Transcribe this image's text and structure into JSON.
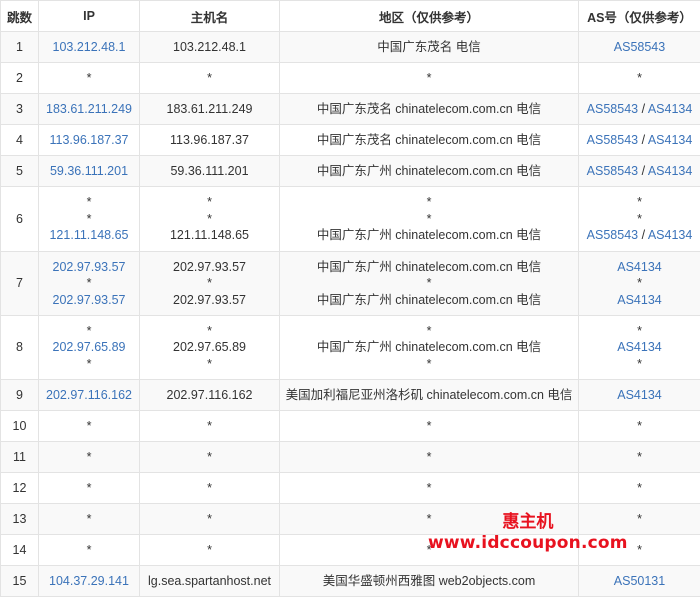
{
  "table": {
    "headers": {
      "hop": "跳数",
      "ip": "IP",
      "host": "主机名",
      "location": "地区（仅供参考）",
      "as": "AS号（仅供参考）"
    },
    "rows": [
      {
        "hop": "1",
        "ip": [
          "103.212.48.1"
        ],
        "host": [
          "103.212.48.1"
        ],
        "loc": [
          "中国广东茂名 电信"
        ],
        "as": [
          [
            "AS58543"
          ]
        ]
      },
      {
        "hop": "2",
        "ip": [
          "*"
        ],
        "host": [
          "*"
        ],
        "loc": [
          "*"
        ],
        "as": [
          [
            "*"
          ]
        ]
      },
      {
        "hop": "3",
        "ip": [
          "183.61.211.249"
        ],
        "host": [
          "183.61.211.249"
        ],
        "loc": [
          "中国广东茂名 chinatelecom.com.cn 电信"
        ],
        "as": [
          [
            "AS58543",
            "AS4134"
          ]
        ]
      },
      {
        "hop": "4",
        "ip": [
          "113.96.187.37"
        ],
        "host": [
          "113.96.187.37"
        ],
        "loc": [
          "中国广东茂名 chinatelecom.com.cn 电信"
        ],
        "as": [
          [
            "AS58543",
            "AS4134"
          ]
        ]
      },
      {
        "hop": "5",
        "ip": [
          "59.36.111.201"
        ],
        "host": [
          "59.36.111.201"
        ],
        "loc": [
          "中国广东广州 chinatelecom.com.cn 电信"
        ],
        "as": [
          [
            "AS58543",
            "AS4134"
          ]
        ]
      },
      {
        "hop": "6",
        "ip": [
          "*",
          "*",
          "121.11.148.65"
        ],
        "host": [
          "*",
          "*",
          "121.11.148.65"
        ],
        "loc": [
          "*",
          "*",
          "中国广东广州 chinatelecom.com.cn 电信"
        ],
        "as": [
          [
            "*"
          ],
          [
            "*"
          ],
          [
            "AS58543",
            "AS4134"
          ]
        ]
      },
      {
        "hop": "7",
        "ip": [
          "202.97.93.57",
          "*",
          "202.97.93.57"
        ],
        "host": [
          "202.97.93.57",
          "*",
          "202.97.93.57"
        ],
        "loc": [
          "中国广东广州 chinatelecom.com.cn 电信",
          "*",
          "中国广东广州 chinatelecom.com.cn 电信"
        ],
        "as": [
          [
            "AS4134"
          ],
          [
            "*"
          ],
          [
            "AS4134"
          ]
        ]
      },
      {
        "hop": "8",
        "ip": [
          "*",
          "202.97.65.89",
          "*"
        ],
        "host": [
          "*",
          "202.97.65.89",
          "*"
        ],
        "loc": [
          "*",
          "中国广东广州 chinatelecom.com.cn 电信",
          "*"
        ],
        "as": [
          [
            "*"
          ],
          [
            "AS4134"
          ],
          [
            "*"
          ]
        ]
      },
      {
        "hop": "9",
        "ip": [
          "202.97.116.162"
        ],
        "host": [
          "202.97.116.162"
        ],
        "loc": [
          "美国加利福尼亚州洛杉矶 chinatelecom.com.cn 电信"
        ],
        "as": [
          [
            "AS4134"
          ]
        ]
      },
      {
        "hop": "10",
        "ip": [
          "*"
        ],
        "host": [
          "*"
        ],
        "loc": [
          "*"
        ],
        "as": [
          [
            "*"
          ]
        ]
      },
      {
        "hop": "11",
        "ip": [
          "*"
        ],
        "host": [
          "*"
        ],
        "loc": [
          "*"
        ],
        "as": [
          [
            "*"
          ]
        ]
      },
      {
        "hop": "12",
        "ip": [
          "*"
        ],
        "host": [
          "*"
        ],
        "loc": [
          "*"
        ],
        "as": [
          [
            "*"
          ]
        ]
      },
      {
        "hop": "13",
        "ip": [
          "*"
        ],
        "host": [
          "*"
        ],
        "loc": [
          "*"
        ],
        "as": [
          [
            "*"
          ]
        ]
      },
      {
        "hop": "14",
        "ip": [
          "*"
        ],
        "host": [
          "*"
        ],
        "loc": [
          "*"
        ],
        "as": [
          [
            "*"
          ]
        ]
      },
      {
        "hop": "15",
        "ip": [
          "104.37.29.141"
        ],
        "host": [
          "lg.sea.spartanhost.net"
        ],
        "loc": [
          "美国华盛顿州西雅图 web2objects.com"
        ],
        "as": [
          [
            "AS50131"
          ]
        ]
      }
    ]
  },
  "watermark": {
    "title": "惠主机",
    "url": "www.idccoupon.com"
  },
  "colors": {
    "link": "#3b73b9",
    "watermark": "#e8121f",
    "border": "#e3e3e3",
    "stripe": "#f9f9f9"
  }
}
